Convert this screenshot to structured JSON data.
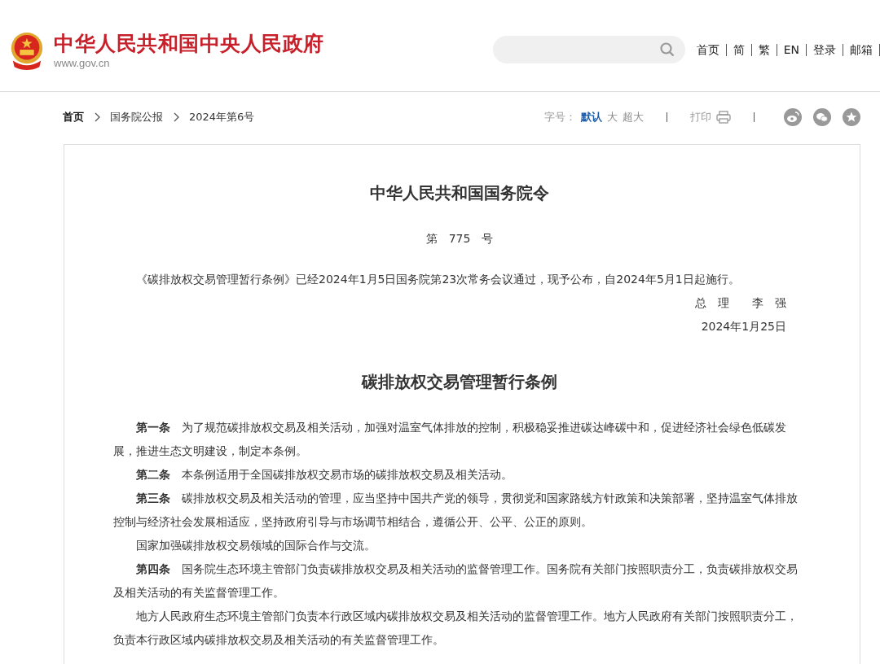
{
  "header": {
    "site_title": "中华人民共和国中央人民政府",
    "site_url": "www.gov.cn",
    "nav": [
      "首页",
      "简",
      "繁",
      "EN",
      "登录",
      "邮箱"
    ]
  },
  "breadcrumb": [
    "首页",
    "国务院公报",
    "2024年第6号"
  ],
  "toolbar": {
    "font_label": "字号：",
    "font_sizes": [
      {
        "label": "默认",
        "selected": true
      },
      {
        "label": "大",
        "selected": false
      },
      {
        "label": "超大",
        "selected": false
      }
    ],
    "print": "打印"
  },
  "order": {
    "title": "中华人民共和国国务院令",
    "number": "第　775　号",
    "announcement": "《碳排放权交易管理暂行条例》已经2024年1月5日国务院第23次常务会议通过，现予公布，自2024年5月1日起施行。",
    "signer": "总　理　　李　强",
    "date": "2024年1月25日"
  },
  "regulation": {
    "title": "碳排放权交易管理暂行条例",
    "paragraphs": [
      "**第一条**　为了规范碳排放权交易及相关活动，加强对温室气体排放的控制，积极稳妥推进碳达峰碳中和，促进经济社会绿色低碳发展，推进生态文明建设，制定本条例。",
      "**第二条**　本条例适用于全国碳排放权交易市场的碳排放权交易及相关活动。",
      "**第三条**　碳排放权交易及相关活动的管理，应当坚持中国共产党的领导，贯彻党和国家路线方针政策和决策部署，坚持温室气体排放控制与经济社会发展相适应，坚持政府引导与市场调节相结合，遵循公开、公平、公正的原则。",
      "国家加强碳排放权交易领域的国际合作与交流。",
      "**第四条**　国务院生态环境主管部门负责碳排放权交易及相关活动的监督管理工作。国务院有关部门按照职责分工，负责碳排放权交易及相关活动的有关监督管理工作。",
      "地方人民政府生态环境主管部门负责本行政区域内碳排放权交易及相关活动的监督管理工作。地方人民政府有关部门按照职责分工，负责本行政区域内碳排放权交易及相关活动的有关监督管理工作。"
    ]
  }
}
